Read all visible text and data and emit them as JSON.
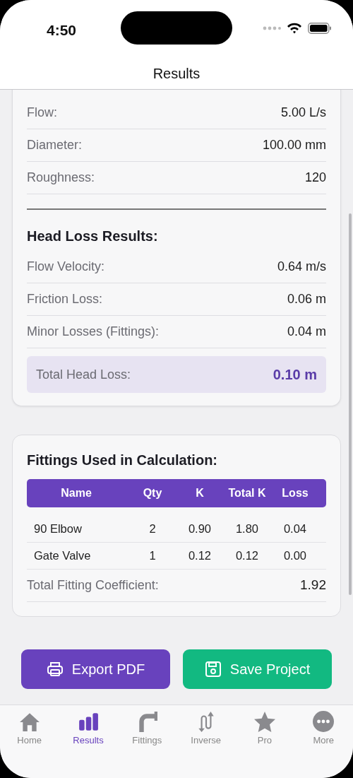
{
  "status_bar": {
    "time": "4:50"
  },
  "header": {
    "title": "Results"
  },
  "input_rows": [
    {
      "label": "Flow:",
      "value": "5.00 L/s"
    },
    {
      "label": "Diameter:",
      "value": "100.00 mm"
    },
    {
      "label": "Roughness:",
      "value": "120"
    }
  ],
  "head_loss": {
    "title": "Head Loss Results:",
    "rows": [
      {
        "label": "Flow Velocity:",
        "value": "0.64 m/s"
      },
      {
        "label": "Friction Loss:",
        "value": "0.06 m"
      },
      {
        "label": "Minor Losses (Fittings):",
        "value": "0.04 m"
      }
    ],
    "total": {
      "label": "Total Head Loss:",
      "value": "0.10 m"
    }
  },
  "fittings": {
    "title": "Fittings Used in Calculation:",
    "columns": [
      "Name",
      "Qty",
      "K",
      "Total K",
      "Loss"
    ],
    "rows": [
      [
        "90 Elbow",
        "2",
        "0.90",
        "1.80",
        "0.04"
      ],
      [
        "Gate Valve",
        "1",
        "0.12",
        "0.12",
        "0.00"
      ]
    ],
    "total": {
      "label": "Total Fitting Coefficient:",
      "value": "1.92"
    }
  },
  "buttons": [
    {
      "kind": "export",
      "label": "Export PDF"
    },
    {
      "kind": "save",
      "label": "Save Project"
    }
  ],
  "tabs": [
    {
      "kind": "home",
      "label": "Home",
      "selected": false
    },
    {
      "kind": "results",
      "label": "Results",
      "selected": true
    },
    {
      "kind": "fittings",
      "label": "Fittings",
      "selected": false
    },
    {
      "kind": "inverse",
      "label": "Inverse",
      "selected": false
    },
    {
      "kind": "pro",
      "label": "Pro",
      "selected": false
    },
    {
      "kind": "more",
      "label": "More",
      "selected": false
    }
  ]
}
